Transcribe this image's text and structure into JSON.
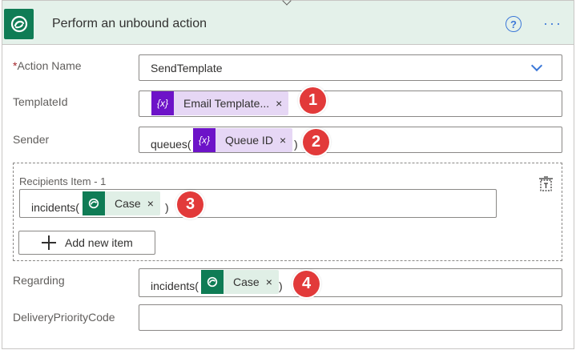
{
  "header": {
    "title": "Perform an unbound action",
    "help_glyph": "?",
    "more_glyph": "···",
    "accent_color": "#0f7c55",
    "header_bg": "#e4f1ea"
  },
  "fields": {
    "action_name": {
      "required_mark": "*",
      "label": "Action Name",
      "value": "SendTemplate"
    },
    "template_id": {
      "label": "TemplateId",
      "token_icon_text": "{x}",
      "token_label": "Email Template...",
      "token_close": "×",
      "badge": "1"
    },
    "sender": {
      "label": "Sender",
      "prefix": "queues(",
      "token_icon_text": "{x}",
      "token_label": "Queue ID",
      "token_close": "×",
      "suffix": ")",
      "badge": "2"
    },
    "recipients": {
      "label": "Recipients Item - 1",
      "prefix": "incidents(",
      "token_label": "Case",
      "token_close": "×",
      "suffix": ")",
      "badge": "3",
      "add_button_label": "Add new item"
    },
    "regarding": {
      "label": "Regarding",
      "prefix": "incidents(",
      "token_label": "Case",
      "token_close": "×",
      "suffix": ")",
      "badge": "4"
    },
    "delivery_priority": {
      "label": "DeliveryPriorityCode",
      "value": ""
    }
  },
  "icons": {
    "logo": "dataverse-icon",
    "help": "help-circle-icon",
    "more": "more-ellipsis-icon",
    "variable": "variable-icon",
    "delete": "delete-array-icon",
    "add": "plus-icon",
    "dropdown": "chevron-down-icon"
  }
}
